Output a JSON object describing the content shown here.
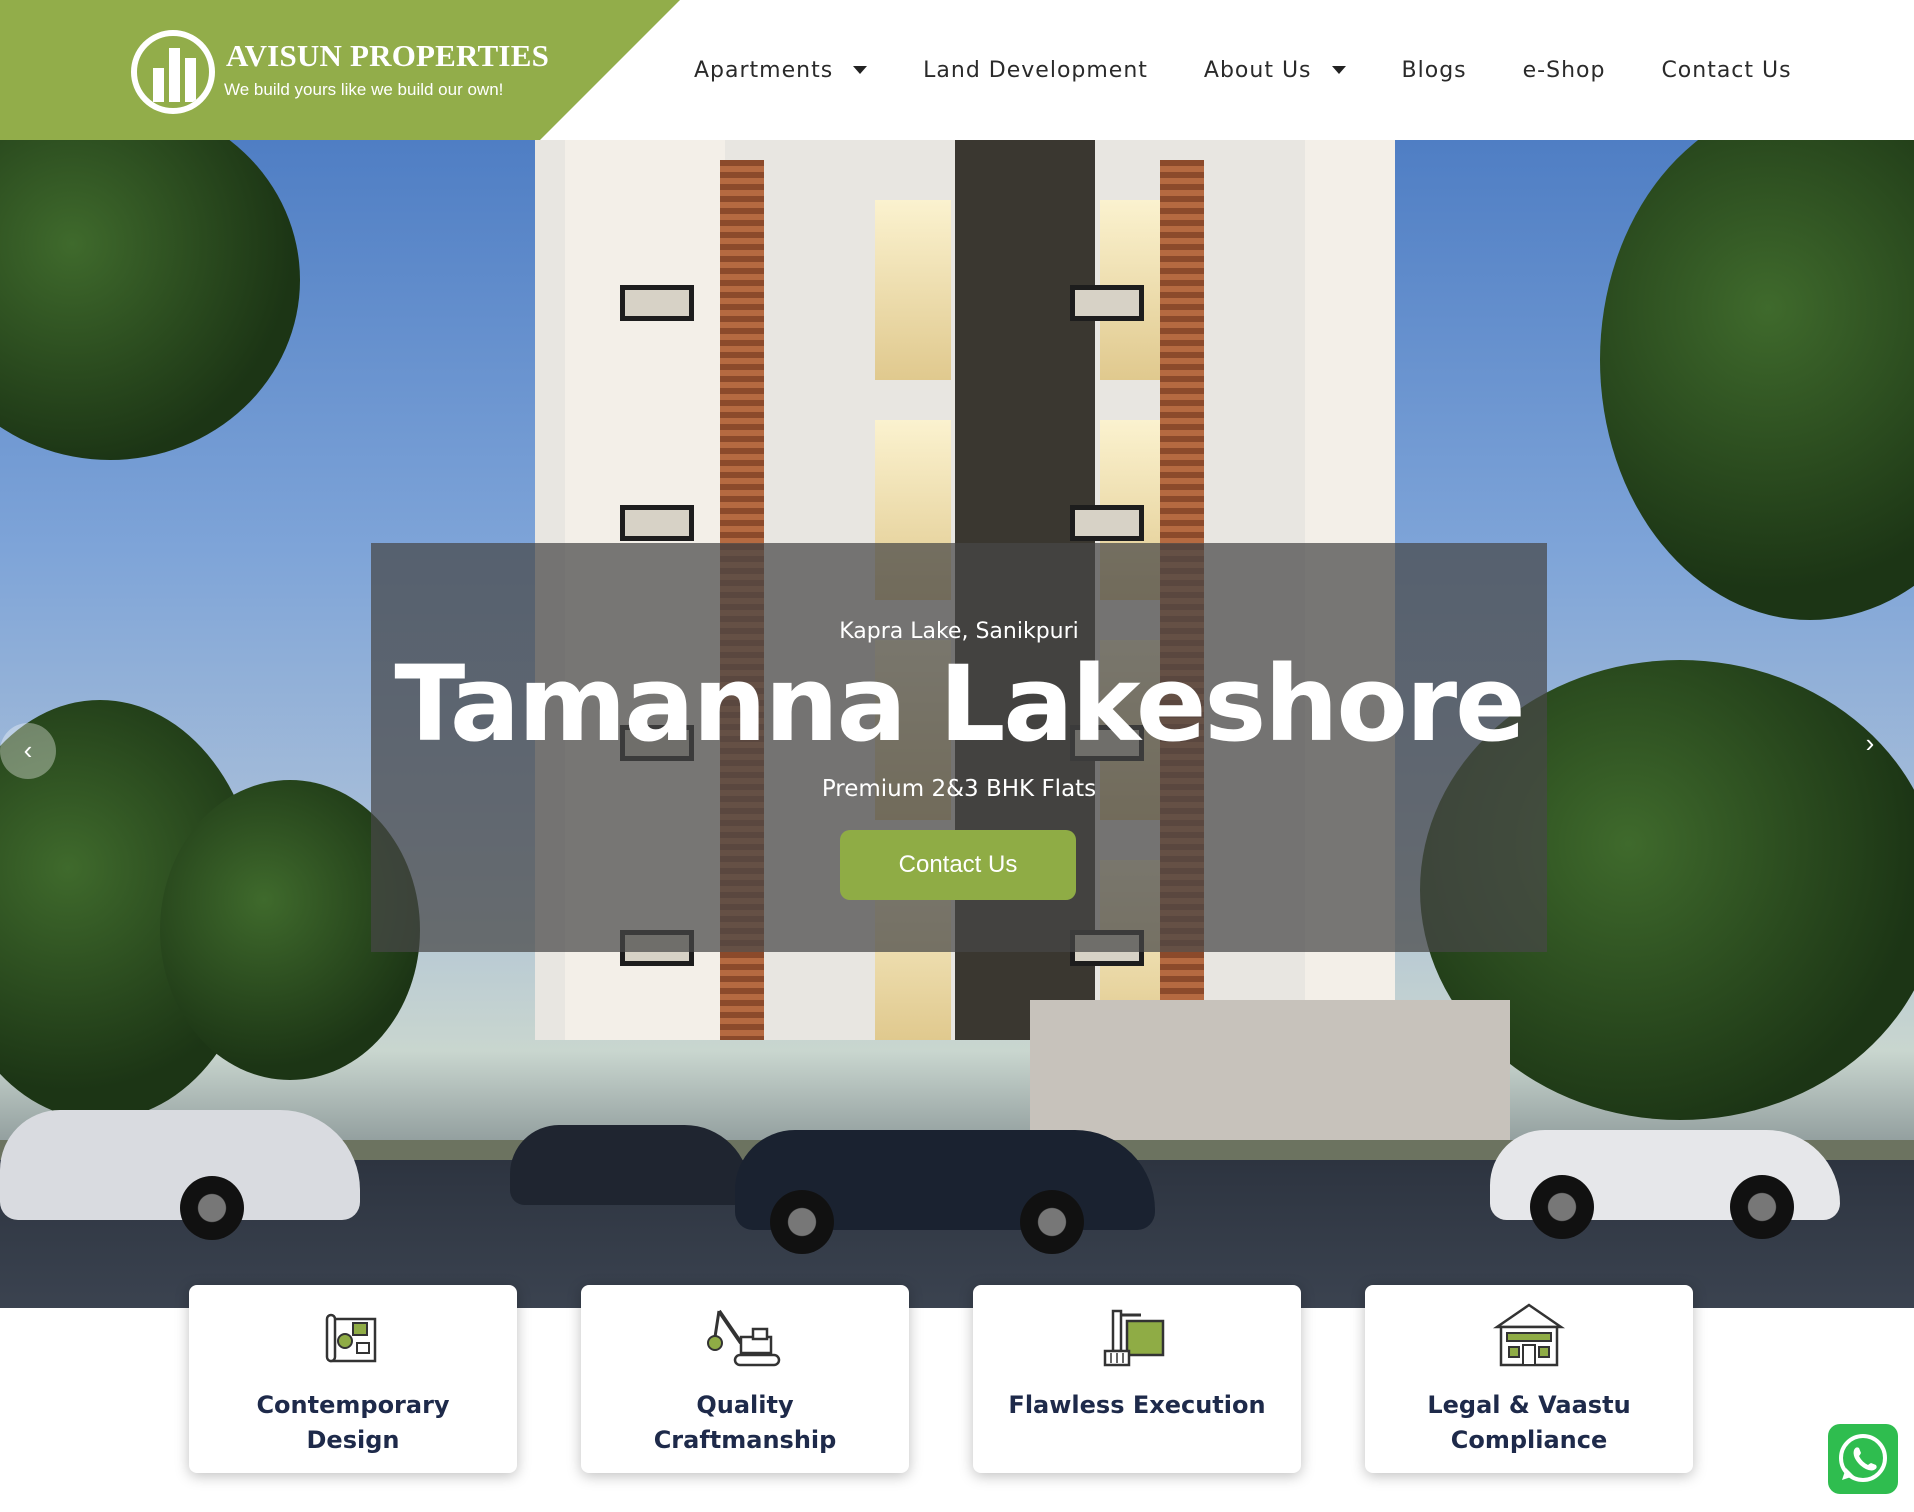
{
  "header": {
    "brand_name": "AVISUN PROPERTIES",
    "tagline": "We build yours like we build our own!",
    "brand_color": "#92ad4a",
    "nav": [
      {
        "label": "Apartments",
        "has_dropdown": true
      },
      {
        "label": "Land Development",
        "has_dropdown": false
      },
      {
        "label": "About Us",
        "has_dropdown": true
      },
      {
        "label": "Blogs",
        "has_dropdown": false
      },
      {
        "label": "e-Shop",
        "has_dropdown": false
      },
      {
        "label": "Contact Us",
        "has_dropdown": false
      }
    ]
  },
  "hero": {
    "location": "Kapra Lake, Sanikpuri",
    "title": "Tamanna Lakeshore",
    "subtitle": "Premium 2&3 BHK Flats",
    "cta_label": "Contact Us",
    "prev_icon": "chevron-left-icon",
    "next_icon": "chevron-right-icon"
  },
  "features": [
    {
      "label": "Contemporary Design",
      "icon": "blueprint-icon"
    },
    {
      "label": "Quality Craftmanship",
      "icon": "excavator-icon"
    },
    {
      "label": "Flawless Execution",
      "icon": "paint-roller-icon"
    },
    {
      "label": "Legal & Vaastu Compliance",
      "icon": "house-icon"
    }
  ],
  "floating": {
    "whatsapp_icon": "whatsapp-icon"
  }
}
